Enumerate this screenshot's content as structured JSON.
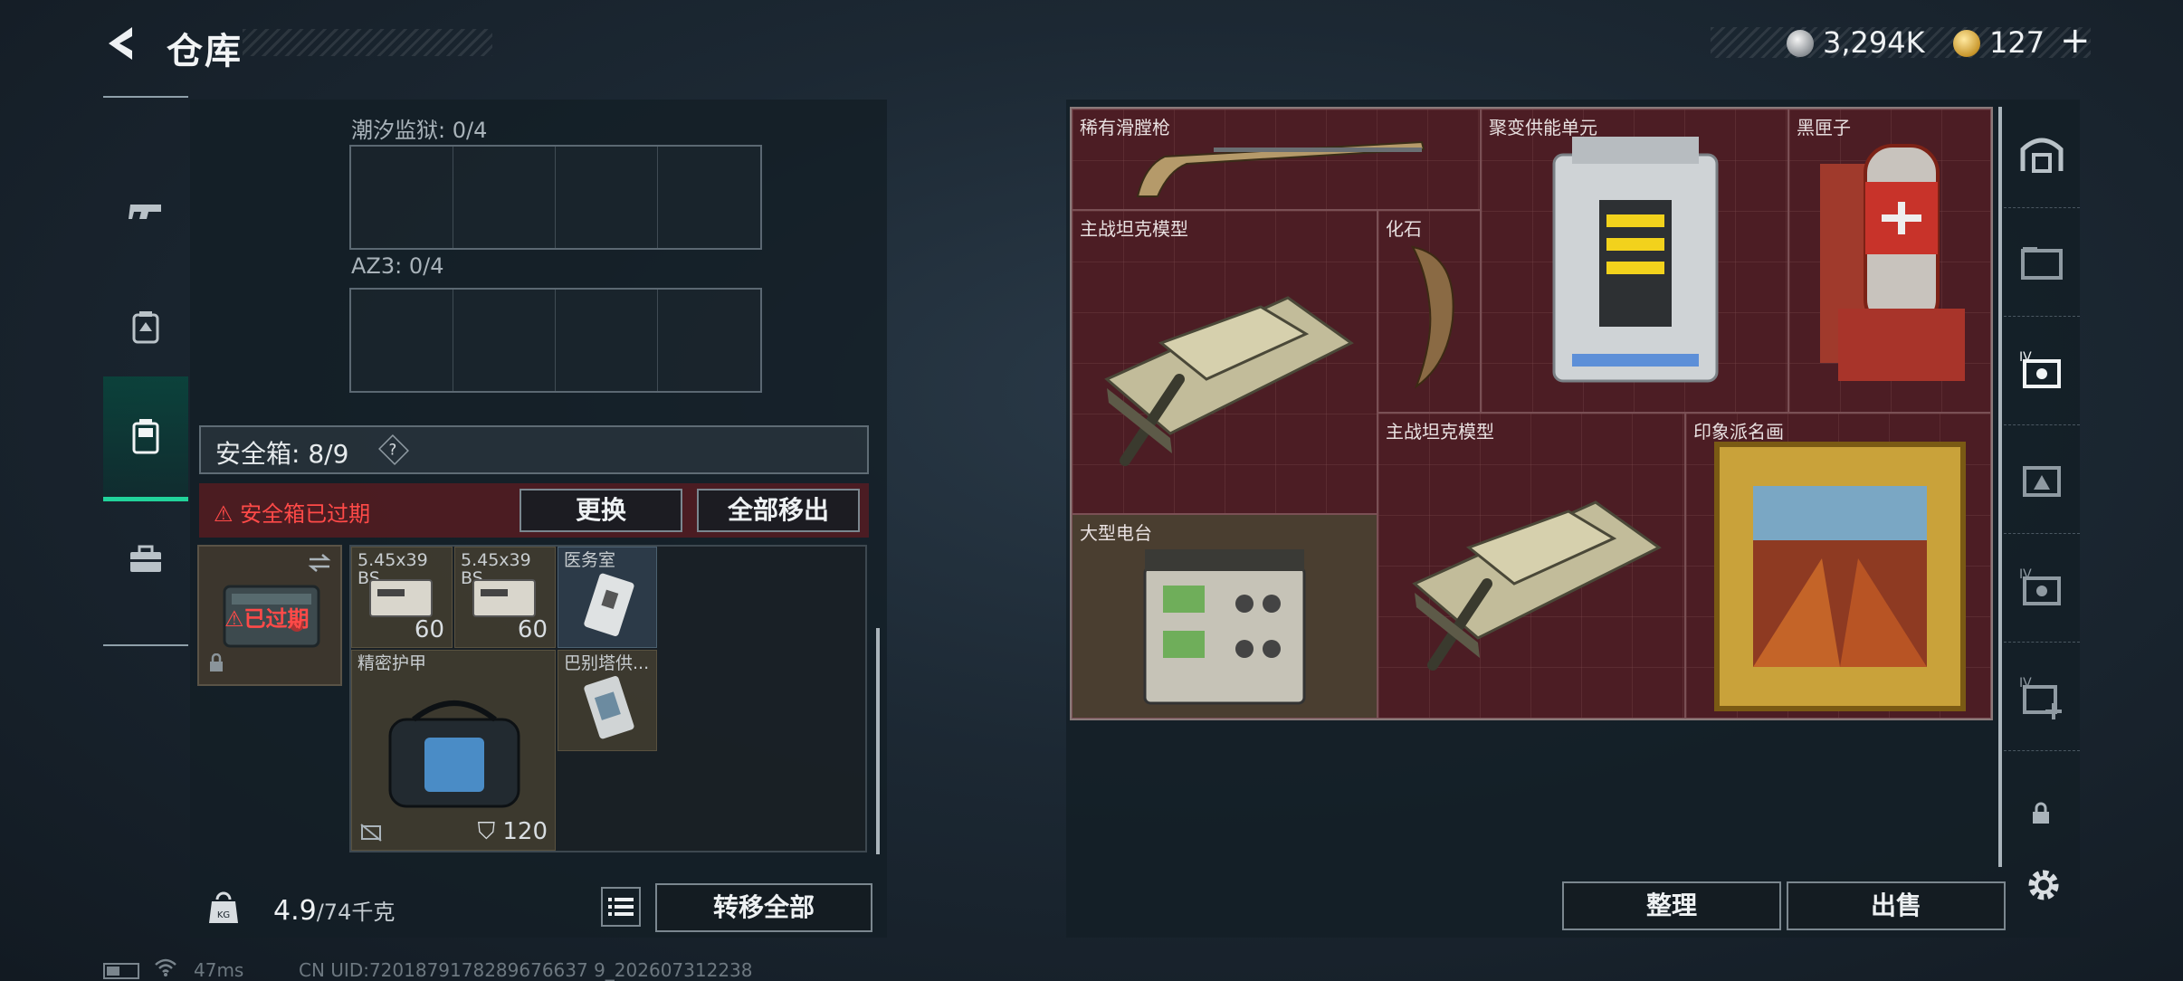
{
  "header": {
    "title": "仓库"
  },
  "currency": {
    "silver": "3,294K",
    "gold": "127",
    "plus": "+"
  },
  "left_nav": [
    {
      "name": "weapons"
    },
    {
      "name": "equipment"
    },
    {
      "name": "safe-box"
    },
    {
      "name": "toolbox"
    }
  ],
  "stash": {
    "section1": "潮汐监狱: 0/4",
    "section2": "AZ3: 0/4",
    "safe_title": "安全箱: 8/9",
    "help": "?",
    "expired_warning": "安全箱已过期",
    "replace_label": "更换",
    "move_all_label": "全部移出",
    "safe_case_status": "已过期",
    "items": [
      {
        "label": "5.45x39\nBS",
        "count": "60"
      },
      {
        "label": "5.45x39\nBS",
        "count": "60"
      },
      {
        "label": "医务室"
      },
      {
        "label": "精密护甲",
        "count": "120"
      },
      {
        "label": "巴别塔供..."
      }
    ],
    "weight": "4.9",
    "weight_max": "/74千克",
    "transfer_all": "转移全部"
  },
  "vault": {
    "items": [
      {
        "label": "稀有滑膛枪"
      },
      {
        "label": "聚变供能单元"
      },
      {
        "label": "黑匣子"
      },
      {
        "label": "主战坦克模型"
      },
      {
        "label": "化石"
      },
      {
        "label": "主战坦克模型"
      },
      {
        "label": "印象派名画"
      },
      {
        "label": "大型电台"
      }
    ],
    "organize": "整理",
    "sell": "出售"
  },
  "status": {
    "ping": "47ms",
    "uid": "CN UID:7201879178289676637 9_202607312238"
  },
  "colors": {
    "accent": "#21d39b",
    "alert": "#ff4a48",
    "vault_bg": "#4c1d24"
  }
}
